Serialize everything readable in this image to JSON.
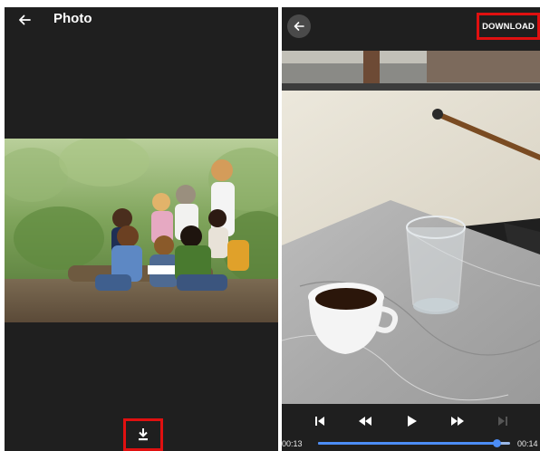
{
  "photo_viewer": {
    "title": "Photo",
    "back_icon": "arrow-left-icon",
    "download_icon": "download-icon"
  },
  "video_viewer": {
    "back_icon": "arrow-left-icon",
    "download_label": "DOWNLOAD",
    "controls": {
      "skip_previous_icon": "skip-previous-icon",
      "rewind_icon": "rewind-icon",
      "play_icon": "play-icon",
      "fast_forward_icon": "fast-forward-icon",
      "skip_next_icon": "skip-next-icon"
    },
    "current_time": "00:13",
    "total_time": "00:14",
    "progress": 0.93
  },
  "colors": {
    "panel_bg": "#1f1f1f",
    "highlight": "#e01010",
    "seek_accent": "#4c8df6"
  }
}
